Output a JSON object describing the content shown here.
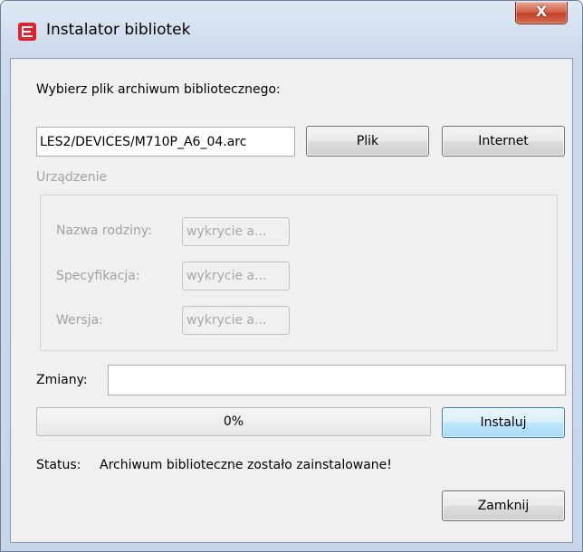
{
  "window": {
    "title": "Instalator bibliotek",
    "close_glyph": "X"
  },
  "archive": {
    "prompt": "Wybierz plik archiwum bibliotecznego:",
    "path": "LES2/DEVICES/M710P_A6_04.arc",
    "file_button": "Plik",
    "internet_button": "Internet"
  },
  "device": {
    "group_label": "Urządzenie",
    "family_label": "Nazwa rodziny:",
    "family_value": "wykrycie a...",
    "spec_label": "Specyfikacja:",
    "spec_value": "wykrycie a...",
    "version_label": "Wersja:",
    "version_value": "wykrycie a..."
  },
  "changes": {
    "label": "Zmiany:",
    "value": ""
  },
  "install": {
    "progress": 0,
    "progress_text": "0%",
    "install_button": "Instaluj"
  },
  "status": {
    "label": "Status:",
    "text": "Archiwum biblioteczne zostało zainstalowane!"
  },
  "footer": {
    "close_button": "Zamknij"
  },
  "colors": {
    "app_icon": "#e0202a",
    "progress_fill": "#06b025"
  }
}
